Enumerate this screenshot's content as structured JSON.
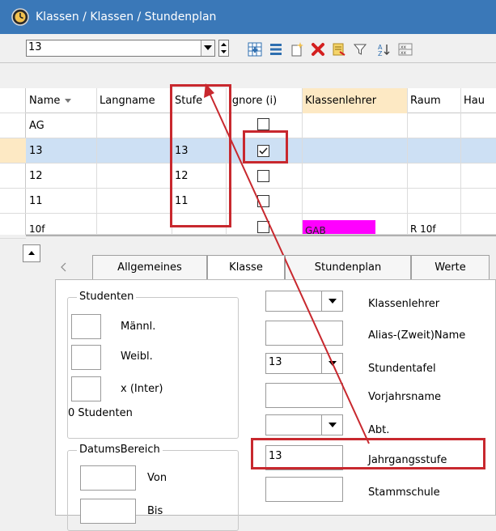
{
  "window": {
    "title": "Klassen / Klassen / Stundenplan"
  },
  "toolbar": {
    "combo_value": "13"
  },
  "grid": {
    "headers": [
      "Name",
      "Langname",
      "Stufe",
      "Ignore (i)",
      "Klassenlehrer",
      "Raum",
      "Hau"
    ],
    "rows": [
      {
        "name": "AG",
        "stufe": "",
        "ignore": false
      },
      {
        "name": "13",
        "stufe": "13",
        "ignore": true
      },
      {
        "name": "12",
        "stufe": "12",
        "ignore": false
      },
      {
        "name": "11",
        "stufe": "11",
        "ignore": false
      },
      {
        "name": "10f",
        "stufe": "",
        "ignore": false,
        "klassenlehrer": "GAB",
        "raum": "R 10f"
      }
    ]
  },
  "tabs": [
    "Allgemeines",
    "Klasse",
    "Stundenplan",
    "Werte"
  ],
  "studenten": {
    "title": "Studenten",
    "maennl": "Männl.",
    "weibl": "Weibl.",
    "inter": "x (Inter)",
    "count": "0 Studenten"
  },
  "datumsbereich": {
    "title": "DatumsBereich",
    "von": "Von",
    "bis": "Bis"
  },
  "fields": {
    "klassenlehrer": "Klassenlehrer",
    "alias": "Alias-(Zweit)Name",
    "stundentafel": "Stundentafel",
    "stundentafel_value": "13",
    "vorjahrsname": "Vorjahrsname",
    "abt": "Abt.",
    "jahrgangsstufe": "Jahrgangsstufe",
    "jahrgangsstufe_value": "13",
    "stammschule": "Stammschule"
  },
  "colors": {
    "titlebar": "#3a78b8",
    "highlight": "#c8282e",
    "row_selected": "#cde0f4",
    "klassenlehrer_header": "#fde9c4",
    "gab_cell": "#ff00ff"
  }
}
